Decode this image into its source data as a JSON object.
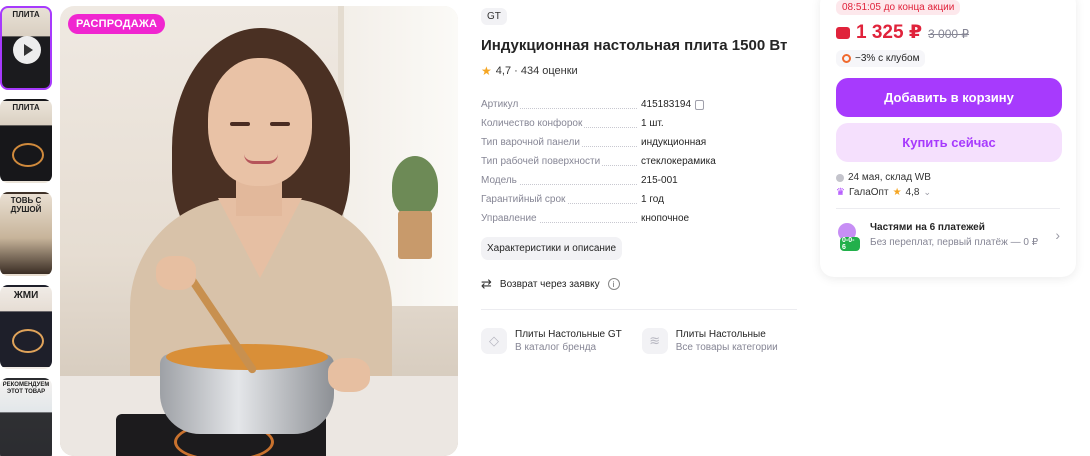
{
  "thumbnails": [
    {
      "caption": "ПЛИТА",
      "active": true,
      "video": true
    },
    {
      "caption": "ПЛИТА",
      "active": false,
      "video": false
    },
    {
      "caption": "ТОВЬ С ДУШОЙ",
      "active": false,
      "video": false
    },
    {
      "caption": "ЖМИ",
      "active": false,
      "video": false
    },
    {
      "caption": "РЕКОМЕНДУЕМ ЭТОТ ТОВАР",
      "active": false,
      "video": false
    }
  ],
  "main_image": {
    "badge": "РАСПРОДАЖА"
  },
  "product": {
    "brand": "GT",
    "title": "Индукционная настольная плита 1500 Вт",
    "rating": "4,7",
    "reviews": "434 оценки",
    "rating_text": "4,7 · 434 оценки"
  },
  "specs": [
    {
      "key": "Артикул",
      "value": "415183194",
      "copy": true
    },
    {
      "key": "Количество конфорок",
      "value": "1 шт."
    },
    {
      "key": "Тип варочной панели",
      "value": "индукционная"
    },
    {
      "key": "Тип рабочей поверхности",
      "value": "стеклокерамика"
    },
    {
      "key": "Модель",
      "value": "215-001"
    },
    {
      "key": "Гарантийный срок",
      "value": "1 год"
    },
    {
      "key": "Управление",
      "value": "кнопочное"
    }
  ],
  "actions": {
    "characteristics_label": "Характеристики и описание",
    "return_label": "Возврат через заявку"
  },
  "links": [
    {
      "title": "Плиты Настольные GT",
      "sub": "В каталог бренда",
      "icon": "tag-icon"
    },
    {
      "title": "Плиты Настольные",
      "sub": "Все товары категории",
      "icon": "layers-icon"
    }
  ],
  "buy_panel": {
    "timer": "08:51:05 до конца акции",
    "price": "1 325 ₽",
    "old_price": "3 000 ₽",
    "club": "−3% с клубом",
    "add_to_cart": "Добавить в корзину",
    "buy_now": "Купить сейчас",
    "delivery": "24 мая, склад WB",
    "seller": "ГалаОпт",
    "seller_rating": "4,8",
    "installments_title": "Частями на 6 платежей",
    "installments_sub": "Без переплат, первый платёж — 0 ₽",
    "installments_tag": "0-0-6"
  },
  "colors": {
    "accent": "#a73afd",
    "price": "#e0233b",
    "sale_badge": "#f026d0"
  }
}
